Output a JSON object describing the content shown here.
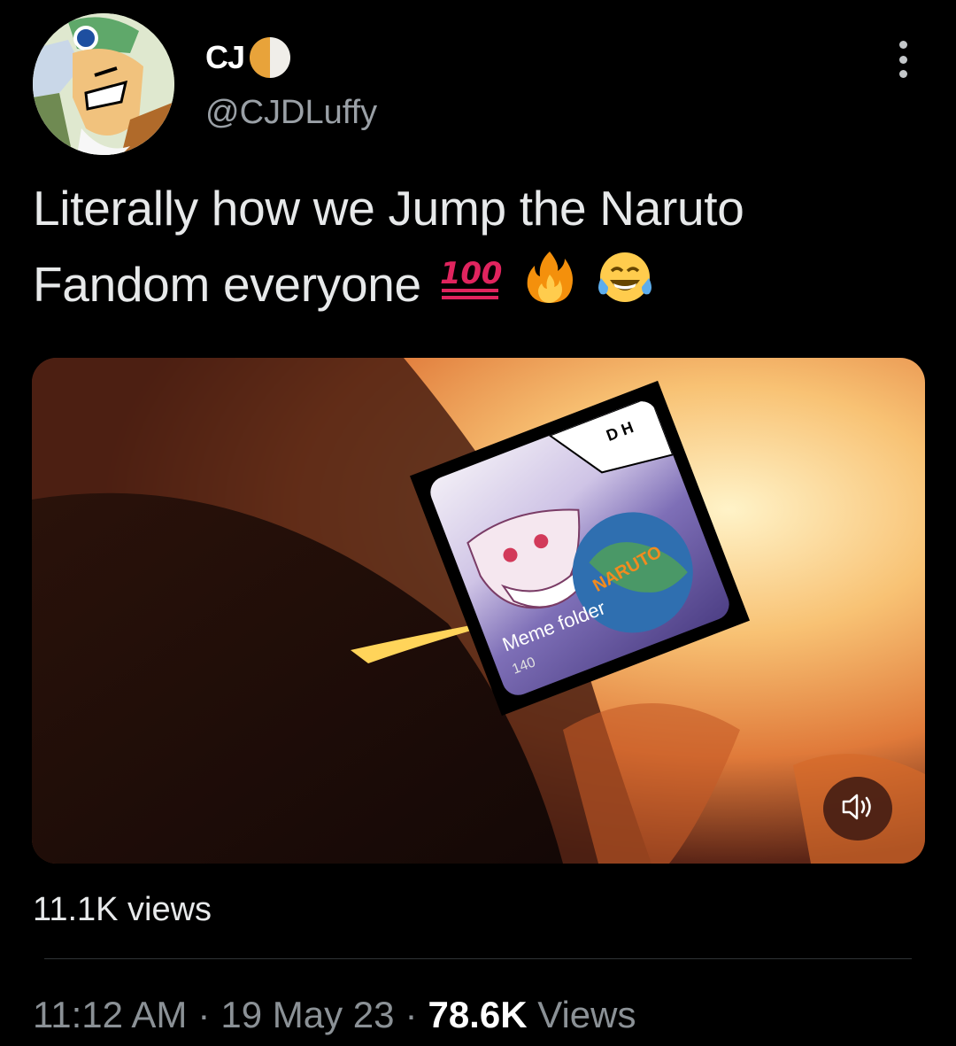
{
  "tweet": {
    "display_name": "CJ",
    "handle": "@CJDLuffy",
    "text": "Literally how we Jump the Naruto Fandom everyone",
    "emojis": [
      "hundred-points-emoji",
      "fire-emoji",
      "tears-of-joy-emoji"
    ],
    "hundred_text": "100"
  },
  "media": {
    "sticker_overlay_text": "D H",
    "folder_title": "Meme folder",
    "folder_count": "140",
    "logo_text": "NARUTO",
    "video_views": "11.1K views"
  },
  "meta": {
    "time": "11:12 AM",
    "date": "19 May 23",
    "views_count": "78.6K",
    "views_label": "Views",
    "separator": "·"
  }
}
